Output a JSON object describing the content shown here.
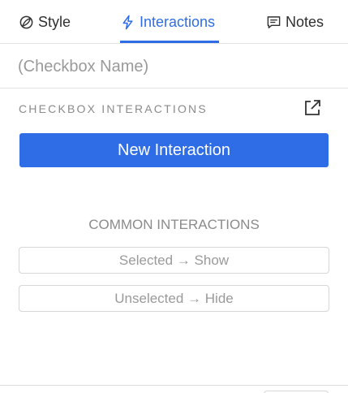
{
  "tabs": {
    "style": {
      "label": "Style",
      "icon": "leaf-icon"
    },
    "interactions": {
      "label": "Interactions",
      "icon": "lightning-icon",
      "active": true
    },
    "notes": {
      "label": "Notes",
      "icon": "comment-icon"
    }
  },
  "name_field": {
    "placeholder": "(Checkbox Name)",
    "value": ""
  },
  "section": {
    "title": "CHECKBOX INTERACTIONS",
    "icon": "external-link-icon"
  },
  "new_interaction_label": "New Interaction",
  "common": {
    "title": "COMMON INTERACTIONS",
    "items": [
      "Selected → Show",
      "Unselected → Hide"
    ]
  },
  "colors": {
    "accent": "#2f6de6",
    "muted": "#8b8b8b",
    "border": "#e3e3e3"
  }
}
